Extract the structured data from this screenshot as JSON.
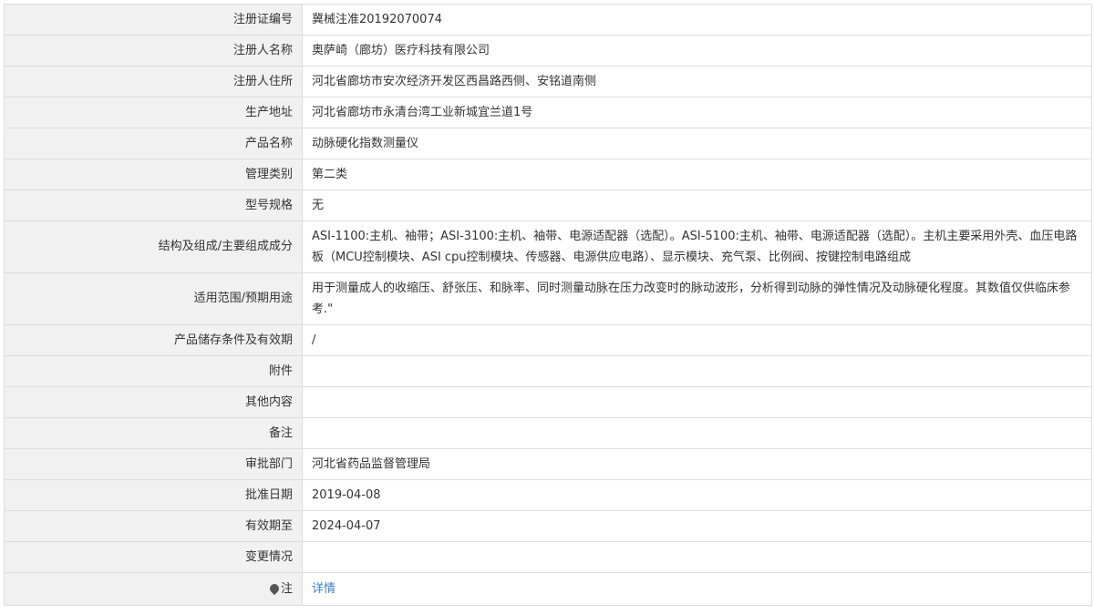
{
  "rows": [
    {
      "label": "注册证编号",
      "value": "冀械注准20192070074"
    },
    {
      "label": "注册人名称",
      "value": "奥萨崎（廊坊）医疗科技有限公司"
    },
    {
      "label": "注册人住所",
      "value": "河北省廊坊市安次经济开发区西昌路西侧、安铭道南侧"
    },
    {
      "label": "生产地址",
      "value": "河北省廊坊市永清台湾工业新城宜兰道1号"
    },
    {
      "label": "产品名称",
      "value": "动脉硬化指数测量仪"
    },
    {
      "label": "管理类别",
      "value": "第二类"
    },
    {
      "label": "型号规格",
      "value": "无"
    },
    {
      "label": "结构及组成/主要组成成分",
      "value": "ASI-1100:主机、袖带；ASI-3100:主机、袖带、电源适配器（选配）。ASI-5100:主机、袖带、电源适配器（选配）。主机主要采用外壳、血压电路板（MCU控制模块、ASI cpu控制模块、传感器、电源供应电路）、显示模块、充气泵、比例阀、按键控制电路组成"
    },
    {
      "label": "适用范围/预期用途",
      "value": "用于测量成人的收缩压、舒张压、和脉率、同时测量动脉在压力改变时的脉动波形，分析得到动脉的弹性情况及动脉硬化程度。其数值仅供临床参考.\""
    },
    {
      "label": "产品储存条件及有效期",
      "value": "/"
    },
    {
      "label": "附件",
      "value": ""
    },
    {
      "label": "其他内容",
      "value": ""
    },
    {
      "label": "备注",
      "value": ""
    },
    {
      "label": "审批部门",
      "value": "河北省药品监督管理局"
    },
    {
      "label": "批准日期",
      "value": "2019-04-08"
    },
    {
      "label": "有效期至",
      "value": "2024-04-07"
    },
    {
      "label": "变更情况",
      "value": ""
    }
  ],
  "note": {
    "icon": "pin-icon",
    "label": "注",
    "link_text": "详情"
  }
}
